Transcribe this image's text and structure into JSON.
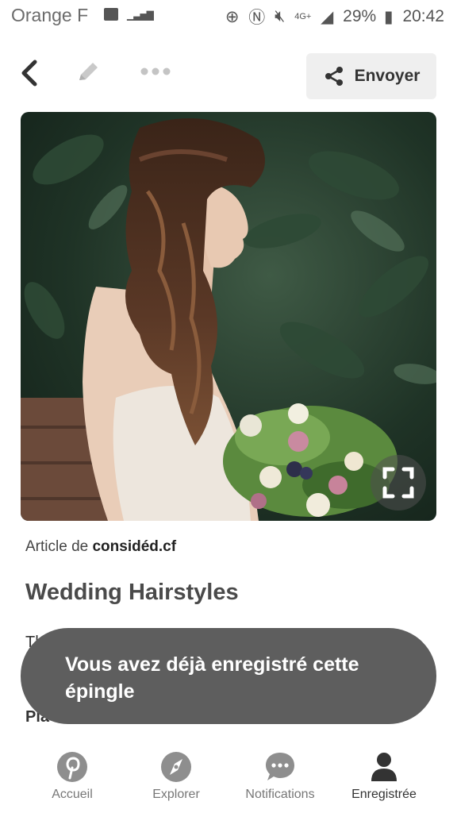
{
  "status_bar": {
    "carrier": "Orange F",
    "battery": "29%",
    "network": "4G+",
    "time": "20:42"
  },
  "toolbar": {
    "share_label": "Envoyer",
    "icons": [
      "chevron-left-icon",
      "pencil-icon",
      "more-dots-icon",
      "share-icon"
    ]
  },
  "pin": {
    "source_prefix": "Article de ",
    "source_domain": "considéd.cf",
    "title": "Wedding Hairstyles",
    "partial_line_1": "Th",
    "partial_line_2": "Pla"
  },
  "toast": {
    "message": "Vous avez déjà enregistré cette épingle"
  },
  "bottom_nav": {
    "items": [
      {
        "label": "Accueil",
        "icon": "pinterest-icon"
      },
      {
        "label": "Explorer",
        "icon": "compass-icon"
      },
      {
        "label": "Notifications",
        "icon": "chat-bubble-icon"
      },
      {
        "label": "Enregistrée",
        "icon": "user-icon"
      }
    ]
  },
  "colors": {
    "toast_bg": "#5e5e5e",
    "share_bg": "#efefef",
    "icon_gray": "#8e8e8e"
  }
}
